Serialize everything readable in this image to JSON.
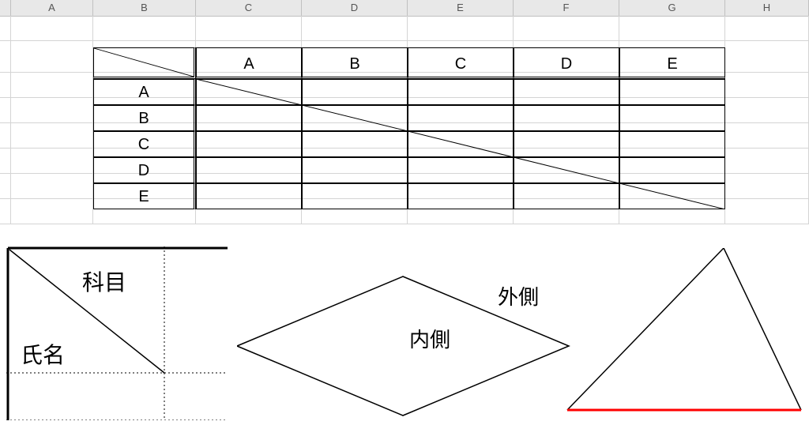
{
  "columns": {
    "A": "A",
    "B": "B",
    "C": "C",
    "D": "D",
    "E": "E",
    "F": "F",
    "G": "G",
    "H": "H"
  },
  "table": {
    "header": {
      "c1": "",
      "c2": "A",
      "c3": "B",
      "c4": "C",
      "c5": "D",
      "c6": "E"
    },
    "rows": [
      {
        "label": "A"
      },
      {
        "label": "B"
      },
      {
        "label": "C"
      },
      {
        "label": "D"
      },
      {
        "label": "E"
      }
    ]
  },
  "annotations": {
    "subject": "科目",
    "name": "氏名",
    "inside": "内側",
    "outside": "外側"
  },
  "colors": {
    "red": "#ff0000"
  }
}
